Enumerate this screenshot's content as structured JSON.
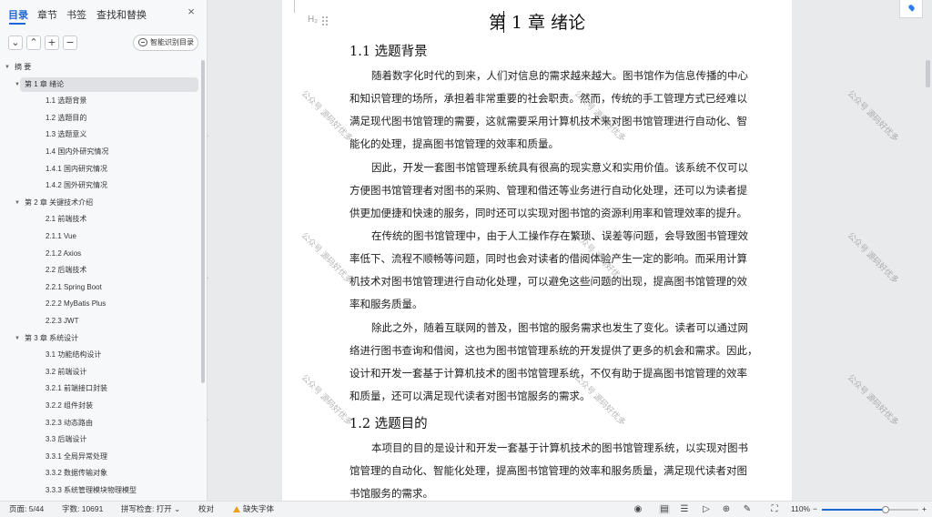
{
  "sidebar": {
    "tabs": [
      "目录",
      "章节",
      "书签",
      "查找和替换"
    ],
    "active_tab": "目录",
    "close_icon": "×",
    "controls": {
      "collapse": "⌄",
      "expand": "⌃",
      "add": "+",
      "remove": "−",
      "smart_label": "智能识别目录"
    },
    "toc": [
      {
        "label": "摘 要",
        "level": 0,
        "caret": "▼"
      },
      {
        "label": "第 1 章 绪论",
        "level": 1,
        "caret": "▼",
        "selected": true
      },
      {
        "label": "1.1 选题背景",
        "level": 2
      },
      {
        "label": "1.2 选题目的",
        "level": 2
      },
      {
        "label": "1.3 选题意义",
        "level": 2
      },
      {
        "label": "1.4 国内外研究情况",
        "level": 2
      },
      {
        "label": "1.4.1 国内研究情况",
        "level": 2
      },
      {
        "label": "1.4.2 国外研究情况",
        "level": 2
      },
      {
        "label": "第 2 章 关键技术介绍",
        "level": 1,
        "caret": "▼"
      },
      {
        "label": "2.1 前端技术",
        "level": 2
      },
      {
        "label": "2.1.1 Vue",
        "level": 2
      },
      {
        "label": "2.1.2 Axios",
        "level": 2
      },
      {
        "label": "2.2 后端技术",
        "level": 2
      },
      {
        "label": "2.2.1 Spring Boot",
        "level": 2
      },
      {
        "label": "2.2.2 MyBatis Plus",
        "level": 2
      },
      {
        "label": "2.2.3 JWT",
        "level": 2
      },
      {
        "label": "第 3 章 系统设计",
        "level": 1,
        "caret": "▼"
      },
      {
        "label": "3.1 功能结构设计",
        "level": 2
      },
      {
        "label": "3.2 前端设计",
        "level": 2
      },
      {
        "label": "3.2.1 前端接口封装",
        "level": 2
      },
      {
        "label": "3.2.2 组件封装",
        "level": 2
      },
      {
        "label": "3.2.3 动态路由",
        "level": 2
      },
      {
        "label": "3.3 后端设计",
        "level": 2
      },
      {
        "label": "3.3.1 全局异常处理",
        "level": 2
      },
      {
        "label": "3.3.2 数据传输对象",
        "level": 2
      },
      {
        "label": "3.3.3 系统管理模块物理模型",
        "level": 2
      }
    ]
  },
  "document": {
    "heading_marker": "H₂",
    "chapter_title": "第 1 章 绪论",
    "sections": [
      {
        "title": "1.1 选题背景",
        "paragraphs": [
          [
            "随着数字化时代的到来，人们对信息的需求越来越大。图书馆作为信息传播的中心",
            "和知识管理的场所，承担着非常重要的社会职责。然而，传统的手工管理方式已经难以",
            "满足现代图书馆管理的需要，这就需要采用计算机技术来对图书馆管理进行自动化、智",
            "能化的处理，提高图书馆管理的效率和质量。"
          ],
          [
            "因此，开发一套图书馆管理系统具有很高的现实意义和实用价值。该系统不仅可以",
            "方便图书馆管理者对图书的采购、管理和借还等业务进行自动化处理，还可以为读者提",
            "供更加便捷和快速的服务，同时还可以实现对图书馆的资源利用率和管理效率的提升。"
          ],
          [
            "在传统的图书馆管理中，由于人工操作存在繁琐、误差等问题，会导致图书管理效",
            "率低下、流程不顺畅等问题，同时也会对读者的借阅体验产生一定的影响。而采用计算",
            "机技术对图书馆管理进行自动化处理，可以避免这些问题的出现，提高图书馆管理的效",
            "率和服务质量。"
          ],
          [
            "除此之外，随着互联网的普及，图书馆的服务需求也发生了变化。读者可以通过网",
            "络进行图书查询和借阅，这也为图书馆管理系统的开发提供了更多的机会和需求。因此，",
            "设计和开发一套基于计算机技术的图书馆管理系统，不仅有助于提高图书馆管理的效率",
            "和质量，还可以满足现代读者对图书馆服务的需求。"
          ]
        ]
      },
      {
        "title": "1.2 选题目的",
        "paragraphs": [
          [
            "本项目的目的是设计和开发一套基于计算机技术的图书馆管理系统，以实现对图书",
            "馆管理的自动化、智能化处理，提高图书馆管理的效率和服务质量，满足现代读者对图",
            "书馆服务的需求。"
          ]
        ]
      }
    ],
    "watermark": "公众号 源码好优多"
  },
  "statusbar": {
    "page": "页面: 5/44",
    "word_count": "字数: 10691",
    "spell_check": "拼写检查: 打开 ⌄",
    "proofread": "校对",
    "missing_font": "缺失字体",
    "zoom": "110%",
    "zoom_minus": "−",
    "zoom_plus": "+",
    "zoom_level": 0.66,
    "icons": [
      "eye-icon",
      "page-view-icon",
      "outline-view-icon",
      "play-icon",
      "web-view-icon",
      "pen-icon",
      "fit-icon"
    ]
  },
  "colors": {
    "accent": "#1e66d6",
    "warning": "#f0a020"
  }
}
